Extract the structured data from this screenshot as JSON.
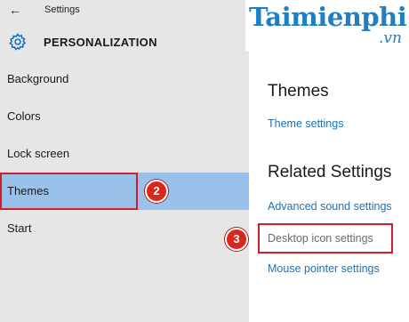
{
  "window": {
    "back_glyph": "←",
    "title": "Settings"
  },
  "header": {
    "icon": "gear-icon",
    "title": "PERSONALIZATION"
  },
  "nav": {
    "items": [
      {
        "label": "Background"
      },
      {
        "label": "Colors"
      },
      {
        "label": "Lock screen"
      },
      {
        "label": "Themes",
        "selected": true
      },
      {
        "label": "Start"
      }
    ]
  },
  "watermark": {
    "brand": "Taimienphi",
    "domain": ".vn"
  },
  "main": {
    "themes_heading": "Themes",
    "theme_settings_link": "Theme settings",
    "related_heading": "Related Settings",
    "links": [
      {
        "label": "Advanced sound settings"
      },
      {
        "label": "Desktop icon settings"
      },
      {
        "label": "Mouse pointer settings"
      }
    ]
  },
  "annotations": {
    "step2": "2",
    "step3": "3",
    "color": "#d31d28"
  },
  "colors": {
    "sidebar_bg": "#e6e6e6",
    "selected_bg": "#99c1ea",
    "link": "#1a73bd",
    "accent": "#0b6bc4"
  }
}
